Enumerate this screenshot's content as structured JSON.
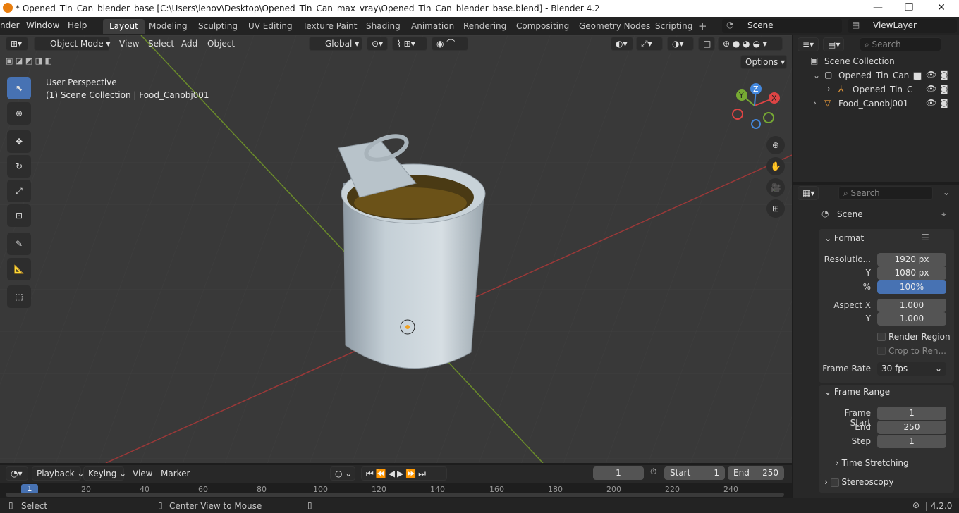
{
  "titlebar": {
    "title": "* Opened_Tin_Can_blender_base [C:\\Users\\lenov\\Desktop\\Opened_Tin_Can_max_vray\\Opened_Tin_Can_blender_base.blend] - Blender 4.2",
    "min": "—",
    "max": "❐",
    "close": "✕"
  },
  "menu": {
    "render": "nder",
    "window": "Window",
    "help": "Help"
  },
  "workspaces": [
    "Layout",
    "Modeling",
    "Sculpting",
    "UV Editing",
    "Texture Paint",
    "Shading",
    "Animation",
    "Rendering",
    "Compositing",
    "Geometry Nodes",
    "Scripting"
  ],
  "scene": "Scene",
  "viewlayer": "ViewLayer",
  "viewport": {
    "mode": "Object Mode",
    "view": "View",
    "select": "Select",
    "add": "Add",
    "object": "Object",
    "orientation": "Global",
    "options": "Options",
    "perspective": "User Perspective",
    "context": "(1) Scene Collection | Food_Canobj001"
  },
  "gizmo": {
    "x": "X",
    "y": "Y",
    "z": "Z"
  },
  "outliner": {
    "search": "Search",
    "root": "Scene Collection",
    "items": [
      "Opened_Tin_Can_la",
      "Opened_Tin_Ca",
      "Food_Canobj001"
    ]
  },
  "props": {
    "search": "Search",
    "scene": "Scene",
    "format": "Format",
    "res_label": "Resolutio...",
    "res_x": "1920 px",
    "y_label": "Y",
    "res_y": "1080 px",
    "pct_label": "%",
    "pct": "100%",
    "aspect_label": "Aspect X",
    "aspect_x": "1.000",
    "aspect_y_label": "Y",
    "aspect_y": "1.000",
    "render_region": "Render Region",
    "crop": "Crop to Ren...",
    "fr_label": "Frame Rate",
    "fr": "30 fps",
    "frame_range": "Frame Range",
    "fs_label": "Frame Start",
    "fs": "1",
    "end_label": "End",
    "end": "250",
    "step_label": "Step",
    "step": "1",
    "time_stretching": "Time Stretching",
    "stereoscopy": "Stereoscopy"
  },
  "timeline": {
    "playback": "Playback",
    "keying": "Keying",
    "view": "View",
    "marker": "Marker",
    "current": "1",
    "start_label": "Start",
    "start": "1",
    "end_label": "End",
    "end": "250",
    "ticks": [
      "1",
      "20",
      "40",
      "60",
      "80",
      "100",
      "120",
      "140",
      "160",
      "180",
      "200",
      "220",
      "240"
    ]
  },
  "status": {
    "select": "Select",
    "center": "Center View to Mouse",
    "version": "4.2.0"
  }
}
